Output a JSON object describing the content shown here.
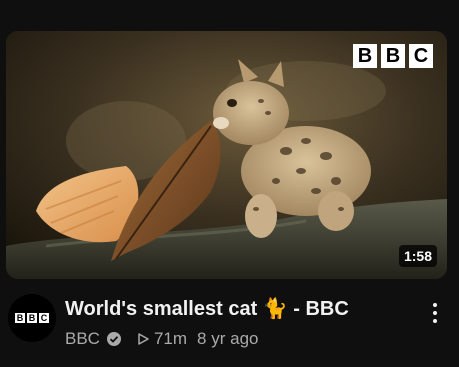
{
  "video": {
    "duration": "1:58",
    "brand_logo_letters": [
      "B",
      "B",
      "C"
    ],
    "title": "World's smallest cat 🐈 - BBC",
    "channel": "BBC",
    "views": "71m",
    "age": "8 yr ago"
  },
  "icons": {
    "verified": "verified-check-icon",
    "views": "play-triangle-icon",
    "more": "vertical-ellipsis-icon"
  },
  "colors": {
    "background": "#0f0f0f",
    "title": "#f1f1f1",
    "secondary": "#aaaaaa"
  }
}
